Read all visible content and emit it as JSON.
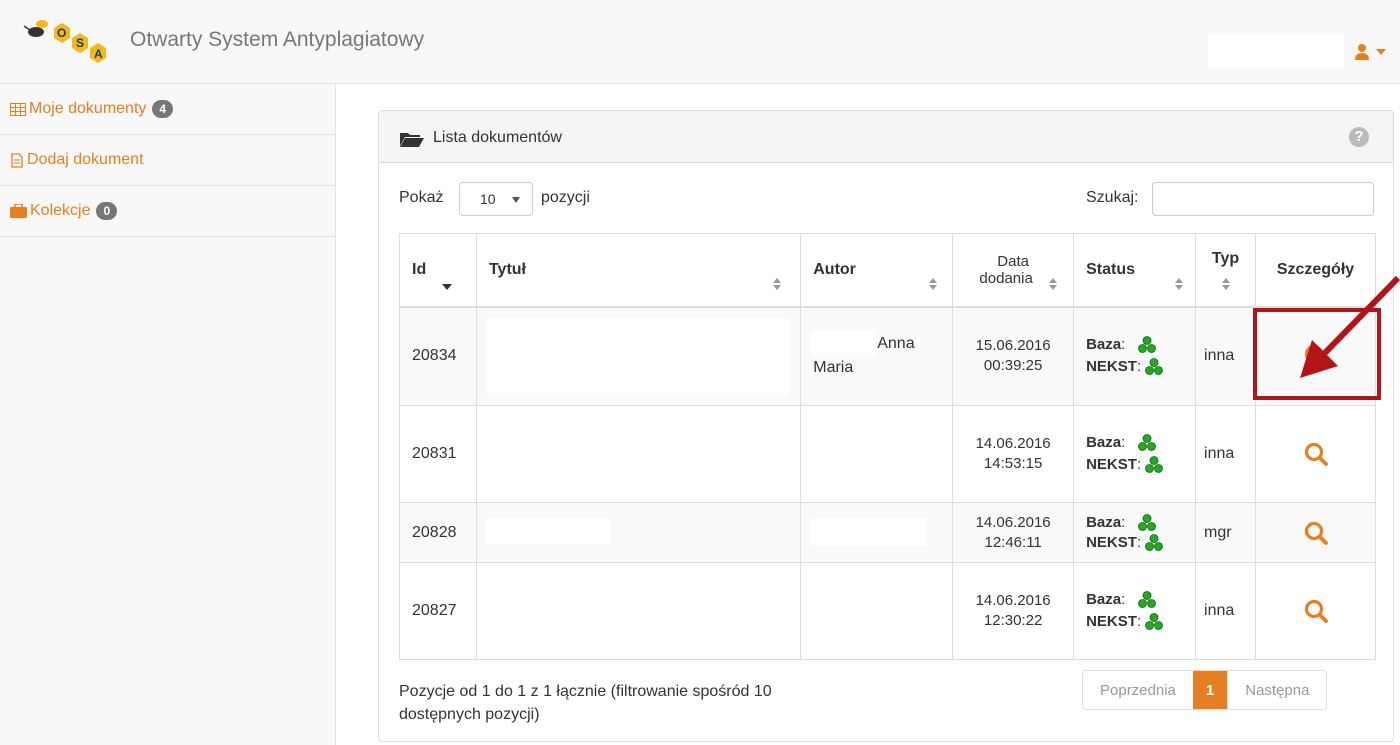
{
  "app": {
    "title": "Otwarty System Antyplagiatowy",
    "logo_letters": "OSA",
    "accent": "#e67e22",
    "user_icon": "user-icon"
  },
  "sidebar": {
    "items": [
      {
        "label": "Moje dokumenty",
        "icon": "table-icon",
        "badge": "4"
      },
      {
        "label": "Dodaj dokument",
        "icon": "file-icon",
        "badge": ""
      },
      {
        "label": "Kolekcje",
        "icon": "briefcase-icon",
        "badge": "0"
      }
    ]
  },
  "panel": {
    "title": "Lista dokumentów",
    "icon": "folder-open-icon",
    "help_icon": "question-circle-icon"
  },
  "controls": {
    "show_label": "Pokaż",
    "page_length": "10",
    "show_suffix": "pozycji",
    "search_label": "Szukaj:",
    "search_value": ""
  },
  "table": {
    "headers": {
      "id": "Id",
      "title": "Tytuł",
      "author": "Autor",
      "date_line1": "Data",
      "date_line2": "dodania",
      "status": "Status",
      "type": "Typ",
      "details": "Szczegóły"
    },
    "rows": [
      {
        "id": "20834",
        "title": "",
        "author_line1": "Anna",
        "author_line2": "Maria",
        "date": "15.06.2016",
        "time": "00:39:25",
        "status_a": "Baza",
        "status_b": "NEKST",
        "type": "inna"
      },
      {
        "id": "20831",
        "title": "",
        "author_line1": "",
        "author_line2": "",
        "date": "14.06.2016",
        "time": "14:53:15",
        "status_a": "Baza",
        "status_b": "NEKST",
        "type": "inna"
      },
      {
        "id": "20828",
        "title": "",
        "author_line1": "",
        "author_line2": "",
        "date": "14.06.2016",
        "time": "12:46:11",
        "status_a": "Baza",
        "status_b": "NEKST",
        "type": "mgr"
      },
      {
        "id": "20827",
        "title": "",
        "author_line1": "",
        "author_line2": "",
        "date": "14.06.2016",
        "time": "12:30:22",
        "status_a": "Baza",
        "status_b": "NEKST",
        "type": "inna"
      }
    ]
  },
  "footer": {
    "info": "Pozycje od 1 do 1 z 1 łącznie (filtrowanie spośród 10 dostępnych pozycji)",
    "prev": "Poprzednia",
    "page": "1",
    "next": "Następna"
  },
  "colors": {
    "status_ok": "#22aa22",
    "highlight": "#b3141a"
  }
}
